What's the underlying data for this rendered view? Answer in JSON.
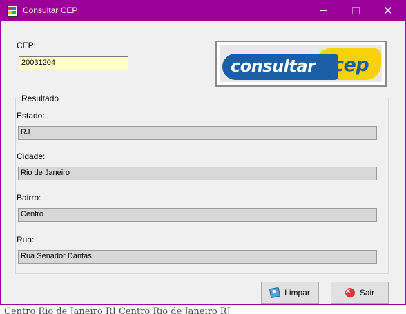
{
  "window": {
    "title": "Consultar CEP",
    "close_glyph": "✕",
    "title_color": "#9b009b"
  },
  "form": {
    "cep_label": "CEP:",
    "cep_value": "20031204"
  },
  "logo": {
    "word1": "consultar",
    "word2": "cep"
  },
  "resultado": {
    "title": "Resultado",
    "estado_label": "Estado:",
    "estado_value": "RJ",
    "cidade_label": "Cidade:",
    "cidade_value": "Rio de Janeiro",
    "bairro_label": "Bairro:",
    "bairro_value": "Centro",
    "rua_label": "Rua:",
    "rua_value": "Rua Senador Dantas"
  },
  "buttons": {
    "limpar_label": "Limpar",
    "sair_label": "Sair",
    "sair_icon_glyph": "✕",
    "limpar_icon": "eraser-icon",
    "sair_icon": "close-circle-icon"
  },
  "background": {
    "text": "Centro      Rio de Janeiro   RJ      Centro   Rio de Janeiro   RJ"
  }
}
